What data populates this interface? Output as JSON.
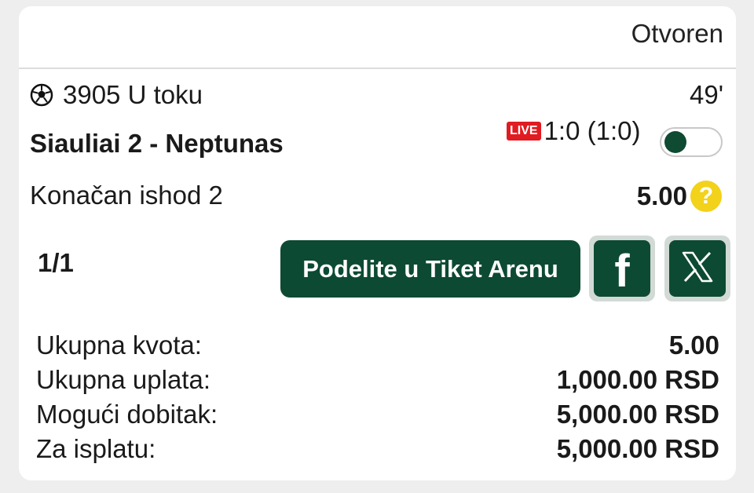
{
  "header": {
    "status": "Otvoren"
  },
  "event": {
    "id_status": "3905 U toku",
    "minute": "49'",
    "match": "Siauliai 2 - Neptunas",
    "live_label": "LIVE",
    "score": "1:0 (1:0)"
  },
  "selection": {
    "market": "Konačan ishod 2",
    "odd": "5.00",
    "help_symbol": "?"
  },
  "ticket": {
    "count": "1/1",
    "share_label": "Podelite u Tiket Arenu",
    "facebook_glyph": "f"
  },
  "totals": [
    {
      "label": "Ukupna kvota:",
      "value": "5.00"
    },
    {
      "label": "Ukupna uplata:",
      "value": "1,000.00 RSD"
    },
    {
      "label": "Mogući dobitak:",
      "value": "5,000.00 RSD"
    },
    {
      "label": "Za isplatu:",
      "value": "5,000.00 RSD"
    }
  ],
  "colors": {
    "brand": "#0d4a33",
    "live": "#e11b22",
    "help": "#f2d21a"
  },
  "icons": [
    "soccer-ball-icon",
    "facebook-icon",
    "x-icon",
    "help-icon"
  ]
}
